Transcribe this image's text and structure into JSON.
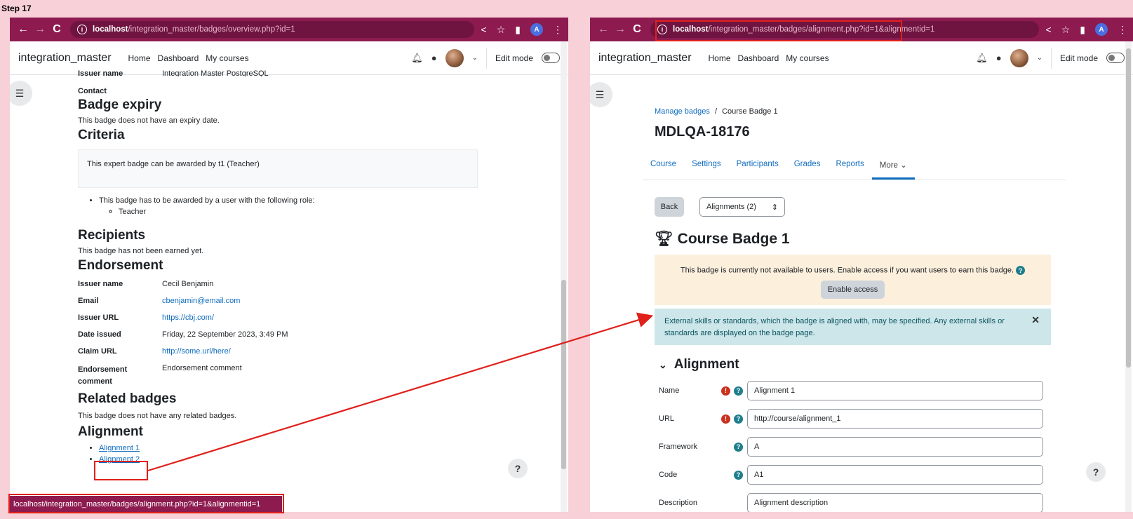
{
  "step_label": "Step 17",
  "left": {
    "url_host": "localhost",
    "url_path": "/integration_master/badges/overview.php?id=1",
    "brand": "integration_master",
    "nav": [
      "Home",
      "Dashboard",
      "My courses"
    ],
    "edit_mode": "Edit mode",
    "issuer_name_cut_label": "Issuer name",
    "issuer_name_cut_value": "Integration Master PostgreSQL",
    "contact_label": "Contact",
    "badge_expiry_heading": "Badge expiry",
    "badge_expiry_text": "This badge does not have an expiry date.",
    "criteria_heading": "Criteria",
    "criteria_box": "This expert badge can be awarded by t1 (Teacher)",
    "criteria_role_text": "This badge has to be awarded by a user with the following role:",
    "criteria_role": "Teacher",
    "recipients_heading": "Recipients",
    "recipients_text": "This badge has not been earned yet.",
    "endorsement_heading": "Endorsement",
    "endorsement": [
      {
        "k": "Issuer name",
        "v": "Cecil Benjamin",
        "link": false
      },
      {
        "k": "Email",
        "v": "cbenjamin@email.com",
        "link": true
      },
      {
        "k": "Issuer URL",
        "v": "https://cbj.com/",
        "link": true
      },
      {
        "k": "Date issued",
        "v": "Friday, 22 September 2023, 3:49 PM",
        "link": false
      },
      {
        "k": "Claim URL",
        "v": "http://some.url/here/",
        "link": true
      },
      {
        "k": "Endorsement comment",
        "v": "Endorsement comment",
        "link": false
      }
    ],
    "related_heading": "Related badges",
    "related_text": "This badge does not have any related badges.",
    "alignment_heading": "Alignment",
    "alignments": [
      "Alignment 1",
      "Alignment 2"
    ],
    "status_url": "localhost/integration_master/badges/alignment.php?id=1&alignmentid=1"
  },
  "right": {
    "url_host": "localhost",
    "url_path": "/integration_master/badges/alignment.php?id=1&alignmentid=1",
    "brand": "integration_master",
    "nav": [
      "Home",
      "Dashboard",
      "My courses"
    ],
    "edit_mode": "Edit mode",
    "breadcrumb_link": "Manage badges",
    "breadcrumb_sep": "/",
    "breadcrumb_current": "Course Badge 1",
    "course_title": "MDLQA-18176",
    "tabs": [
      "Course",
      "Settings",
      "Participants",
      "Grades",
      "Reports",
      "More"
    ],
    "back_label": "Back",
    "select_value": "Alignments (2)",
    "badge_title": "Course Badge 1",
    "warning_text": "This badge is currently not available to users. Enable access if you want users to earn this badge.",
    "enable_access": "Enable access",
    "info_text": "External skills or standards, which the badge is aligned with, may be specified. Any external skills or standards are displayed on the badge page.",
    "alignment_heading": "Alignment",
    "fields": [
      {
        "label": "Name",
        "value": "Alignment 1",
        "required": true
      },
      {
        "label": "URL",
        "value": "http://course/alignment_1",
        "required": true
      },
      {
        "label": "Framework",
        "value": "A",
        "required": false
      },
      {
        "label": "Code",
        "value": "A1",
        "required": false
      },
      {
        "label": "Description",
        "value": "Alignment description",
        "required": false
      }
    ]
  },
  "colors": {
    "chrome": "#8d1b4f",
    "annotation": "#e0201b",
    "link": "#0f6cbf",
    "background": "#f7d0d8"
  }
}
